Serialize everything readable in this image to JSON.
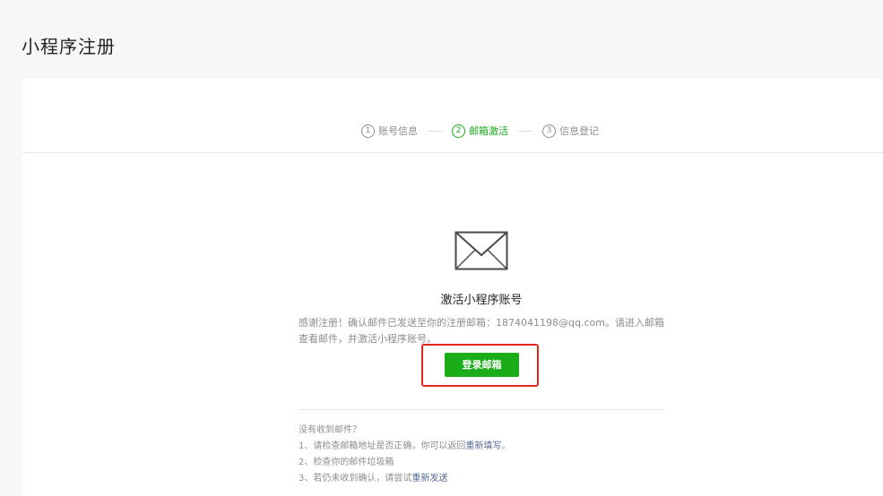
{
  "page": {
    "title": "小程序注册"
  },
  "steps": [
    {
      "num": "1",
      "label": "账号信息",
      "state": "done"
    },
    {
      "num": "2",
      "label": "邮箱激活",
      "state": "active"
    },
    {
      "num": "3",
      "label": "信息登记",
      "state": "todo"
    }
  ],
  "main": {
    "icon": "envelope-icon",
    "heading": "激活小程序账号",
    "description": "感谢注册！确认邮件已发送至你的注册邮箱：1874041198@qq.com。请进入邮箱查看邮件，并激活小程序账号。",
    "login_button": "登录邮箱"
  },
  "help": {
    "title": "没有收到邮件？",
    "item1_prefix": "1、请检查邮箱地址是否正确，你可以返回",
    "item1_link": "重新填写",
    "item1_suffix": "。",
    "item2": "2、检查你的邮件垃圾箱",
    "item3_prefix": "3、若仍未收到确认，请尝试",
    "item3_link": "重新发送"
  },
  "colors": {
    "accent": "#1aad19",
    "link": "#576b95",
    "highlight_box": "#e0271b"
  }
}
